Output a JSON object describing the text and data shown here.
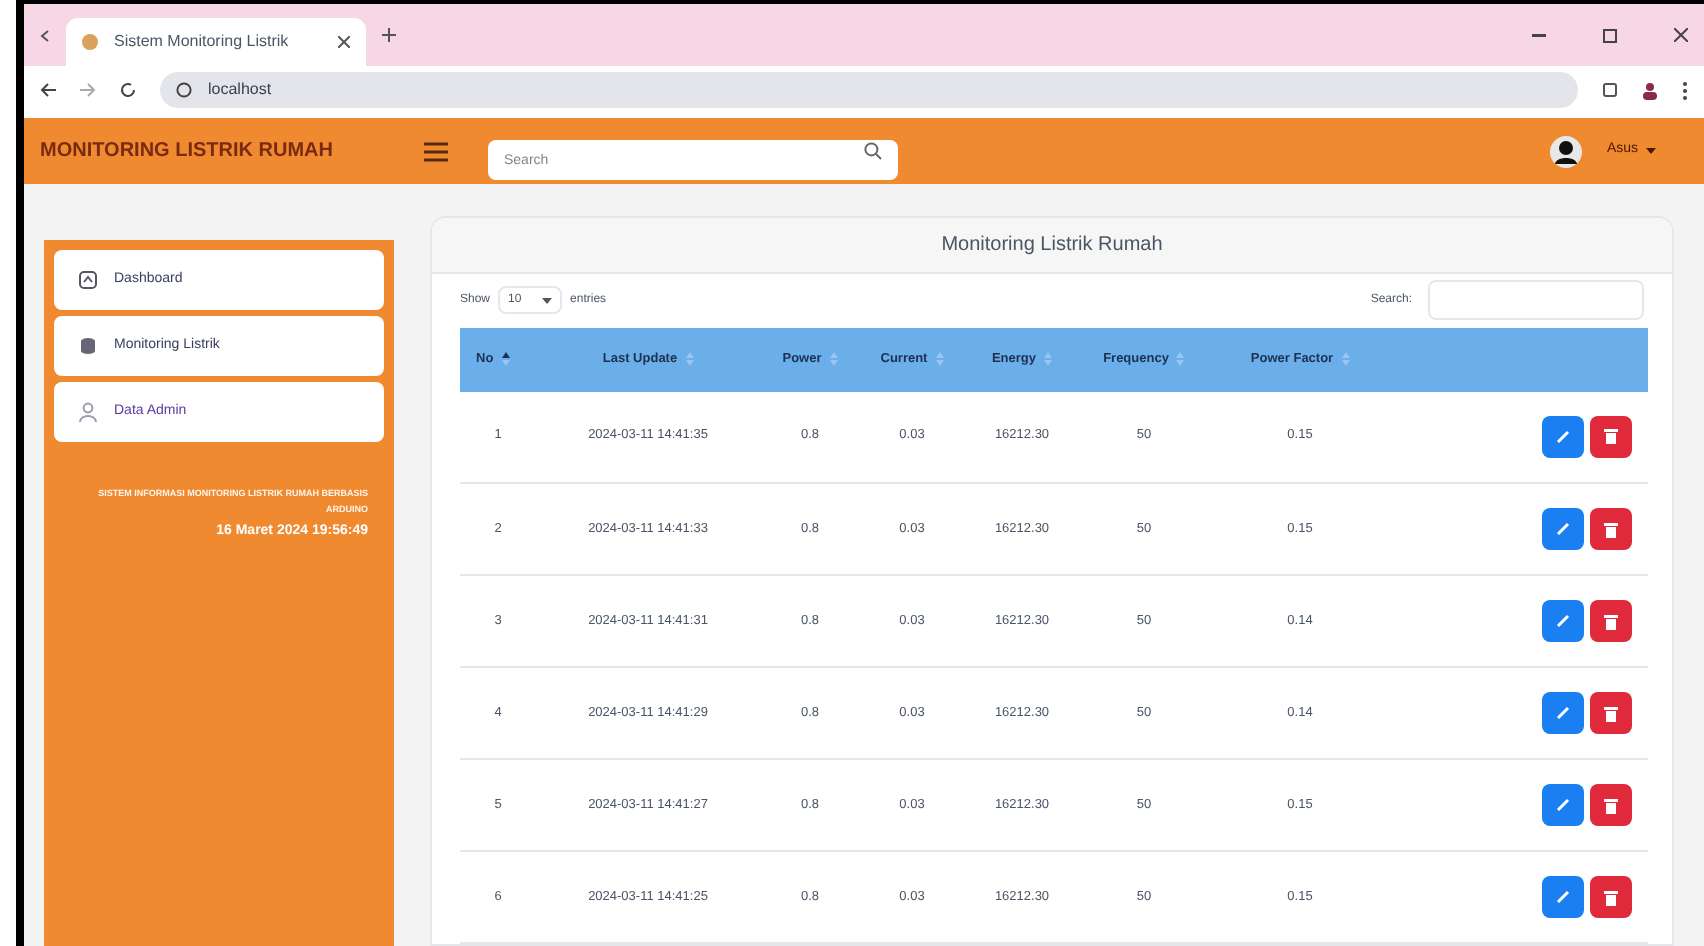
{
  "browser": {
    "tab_title": "Sistem Monitoring Listrik",
    "url": "localhost"
  },
  "header": {
    "brand": "MONITORING LISTRIK RUMAH",
    "search": {
      "placeholder": "Search"
    },
    "user": "Asus"
  },
  "sidebar": {
    "items": [
      {
        "label": "Dashboard",
        "kind": "dashboard",
        "selected": false
      },
      {
        "label": "Monitoring Listrik",
        "kind": "database",
        "selected": false
      },
      {
        "label": "Data Admin",
        "kind": "user",
        "selected": true
      }
    ],
    "caption": "SISTEM INFORMASI MONITORING LISTRIK RUMAH BERBASIS ARDUINO",
    "datetime": "16 Maret 2024 19:56:49"
  },
  "card": {
    "title": "Monitoring Listrik Rumah",
    "show_label": "Show",
    "page_size": "10",
    "entries_label": "entries",
    "search_label": "Search:",
    "table": {
      "columns": [
        "No",
        "Last Update",
        "Power",
        "Current",
        "Energy",
        "Frequency",
        "Power Factor",
        ""
      ],
      "rows": [
        [
          "1",
          "2024-03-11 14:41:35",
          "0.8",
          "0.03",
          "16212.30",
          "50",
          "0.15"
        ],
        [
          "2",
          "2024-03-11 14:41:33",
          "0.8",
          "0.03",
          "16212.30",
          "50",
          "0.15"
        ],
        [
          "3",
          "2024-03-11 14:41:31",
          "0.8",
          "0.03",
          "16212.30",
          "50",
          "0.14"
        ],
        [
          "4",
          "2024-03-11 14:41:29",
          "0.8",
          "0.03",
          "16212.30",
          "50",
          "0.14"
        ],
        [
          "5",
          "2024-03-11 14:41:27",
          "0.8",
          "0.03",
          "16212.30",
          "50",
          "0.15"
        ],
        [
          "6",
          "2024-03-11 14:41:25",
          "0.8",
          "0.03",
          "16212.30",
          "50",
          "0.15"
        ]
      ]
    }
  }
}
